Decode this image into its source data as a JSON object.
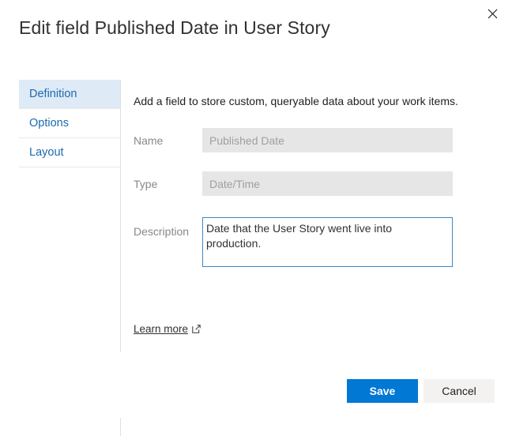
{
  "dialog": {
    "title": "Edit field Published Date in User Story",
    "close_icon": "close-icon"
  },
  "tabs": [
    {
      "label": "Definition",
      "selected": true
    },
    {
      "label": "Options",
      "selected": false
    },
    {
      "label": "Layout",
      "selected": false
    }
  ],
  "content": {
    "intro": "Add a field to store custom, queryable data about your work items.",
    "fields": [
      {
        "label": "Name",
        "value": "Published Date",
        "placeholder": "Published Date"
      },
      {
        "label": "Type",
        "value": "Date/Time",
        "placeholder": "Date/Time"
      }
    ],
    "description": {
      "label": "Description",
      "value": "Date that the User Story went live into production.",
      "placeholder": ""
    },
    "learn_more": {
      "label": "Learn more",
      "icon": "external-link-icon"
    }
  },
  "footer": {
    "save_label": "Save",
    "cancel_label": "Cancel"
  },
  "colors": {
    "primary": "#0078d4",
    "tab_selected_bg": "#deeaf6",
    "tab_text": "#1d6ab0",
    "field_disabled_bg": "#e7e6e6",
    "focus_border": "#3b87c9",
    "secondary_btn_bg": "#f3f2f1"
  }
}
